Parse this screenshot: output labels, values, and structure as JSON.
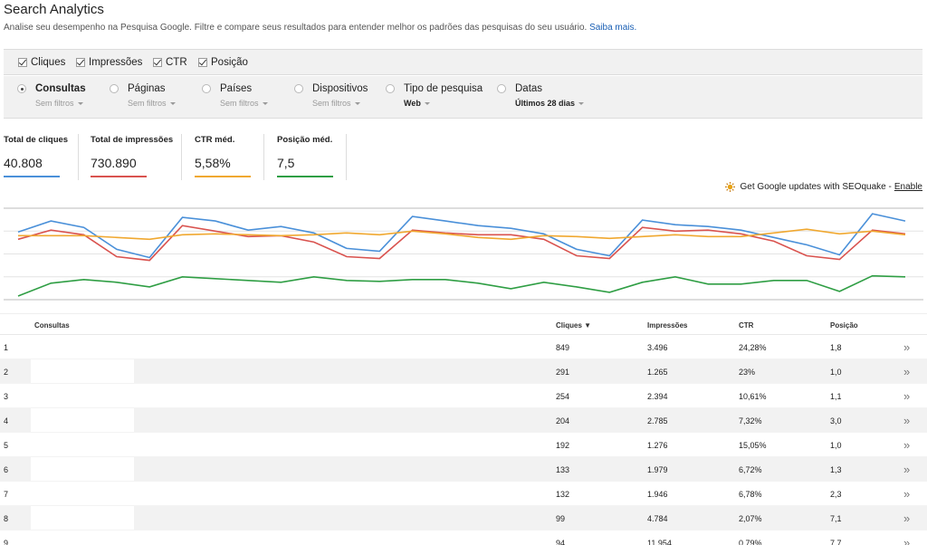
{
  "header": {
    "title": "Search Analytics",
    "subtitle": "Analise seu desempenho na Pesquisa Google. Filtre e compare seus resultados para entender melhor os padrões das pesquisas do seu usuário.",
    "learn_more": "Saiba mais."
  },
  "metric_checks": [
    {
      "label": "Cliques",
      "checked": true
    },
    {
      "label": "Impressões",
      "checked": true
    },
    {
      "label": "CTR",
      "checked": true
    },
    {
      "label": "Posição",
      "checked": true
    }
  ],
  "filters": [
    {
      "label": "Consultas",
      "sub": "Sem filtros",
      "selected": true
    },
    {
      "label": "Páginas",
      "sub": "Sem filtros",
      "selected": false
    },
    {
      "label": "Países",
      "sub": "Sem filtros",
      "selected": false
    },
    {
      "label": "Dispositivos",
      "sub": "Sem filtros",
      "selected": false
    },
    {
      "label": "Tipo de pesquisa",
      "sub": "Web",
      "selected": false
    },
    {
      "label": "Datas",
      "sub": "Últimos 28 dias",
      "selected": false
    }
  ],
  "totals": [
    {
      "label": "Total de cliques",
      "value": "40.808",
      "color": "#4a90d9"
    },
    {
      "label": "Total de impressões",
      "value": "730.890",
      "color": "#d9534f"
    },
    {
      "label": "CTR méd.",
      "value": "5,58%",
      "color": "#f0a830"
    },
    {
      "label": "Posição méd.",
      "value": "7,5",
      "color": "#2f9e44"
    }
  ],
  "seoquake": {
    "text": "Get Google updates with SEOquake -",
    "link": "Enable"
  },
  "chart_data": {
    "type": "line",
    "x": [
      1,
      2,
      3,
      4,
      5,
      6,
      7,
      8,
      9,
      10,
      11,
      12,
      13,
      14,
      15,
      16,
      17,
      18,
      19,
      20,
      21,
      22,
      23,
      24,
      25,
      26,
      27,
      28,
      29,
      30
    ],
    "series": [
      {
        "color": "#4a90d9",
        "values": [
          0.74,
          0.86,
          0.79,
          0.55,
          0.46,
          0.9,
          0.86,
          0.76,
          0.8,
          0.73,
          0.56,
          0.53,
          0.91,
          0.86,
          0.81,
          0.78,
          0.72,
          0.55,
          0.48,
          0.87,
          0.82,
          0.8,
          0.76,
          0.68,
          0.6,
          0.49,
          0.94,
          0.86
        ]
      },
      {
        "color": "#d9534f",
        "values": [
          0.66,
          0.76,
          0.71,
          0.47,
          0.43,
          0.81,
          0.75,
          0.69,
          0.7,
          0.63,
          0.47,
          0.45,
          0.76,
          0.73,
          0.71,
          0.71,
          0.66,
          0.48,
          0.45,
          0.79,
          0.75,
          0.76,
          0.72,
          0.64,
          0.48,
          0.44,
          0.76,
          0.72
        ]
      },
      {
        "color": "#f0a830",
        "values": [
          0.7,
          0.7,
          0.7,
          0.68,
          0.66,
          0.71,
          0.72,
          0.71,
          0.7,
          0.71,
          0.73,
          0.71,
          0.75,
          0.72,
          0.68,
          0.66,
          0.7,
          0.69,
          0.67,
          0.69,
          0.71,
          0.69,
          0.69,
          0.73,
          0.77,
          0.72,
          0.75,
          0.71
        ]
      },
      {
        "color": "#2f9e44",
        "values": [
          0.04,
          0.18,
          0.22,
          0.19,
          0.14,
          0.25,
          0.23,
          0.21,
          0.19,
          0.25,
          0.21,
          0.2,
          0.22,
          0.22,
          0.18,
          0.12,
          0.19,
          0.14,
          0.08,
          0.19,
          0.25,
          0.17,
          0.17,
          0.21,
          0.21,
          0.09,
          0.26,
          0.25
        ]
      }
    ]
  },
  "table": {
    "headers": {
      "query": "Consultas",
      "clicks": "Cliques ▼",
      "impressions": "Impressões",
      "ctr": "CTR",
      "position": "Posição"
    },
    "rows": [
      {
        "n": "1",
        "clicks": "849",
        "impressions": "3.496",
        "ctr": "24,28%",
        "position": "1,8"
      },
      {
        "n": "2",
        "clicks": "291",
        "impressions": "1.265",
        "ctr": "23%",
        "position": "1,0"
      },
      {
        "n": "3",
        "clicks": "254",
        "impressions": "2.394",
        "ctr": "10,61%",
        "position": "1,1"
      },
      {
        "n": "4",
        "clicks": "204",
        "impressions": "2.785",
        "ctr": "7,32%",
        "position": "3,0"
      },
      {
        "n": "5",
        "clicks": "192",
        "impressions": "1.276",
        "ctr": "15,05%",
        "position": "1,0"
      },
      {
        "n": "6",
        "clicks": "133",
        "impressions": "1.979",
        "ctr": "6,72%",
        "position": "1,3"
      },
      {
        "n": "7",
        "clicks": "132",
        "impressions": "1.946",
        "ctr": "6,78%",
        "position": "2,3"
      },
      {
        "n": "8",
        "clicks": "99",
        "impressions": "4.784",
        "ctr": "2,07%",
        "position": "7,1"
      },
      {
        "n": "9",
        "clicks": "94",
        "impressions": "11.954",
        "ctr": "0,79%",
        "position": "7,7"
      }
    ],
    "row_arrow": "»"
  }
}
